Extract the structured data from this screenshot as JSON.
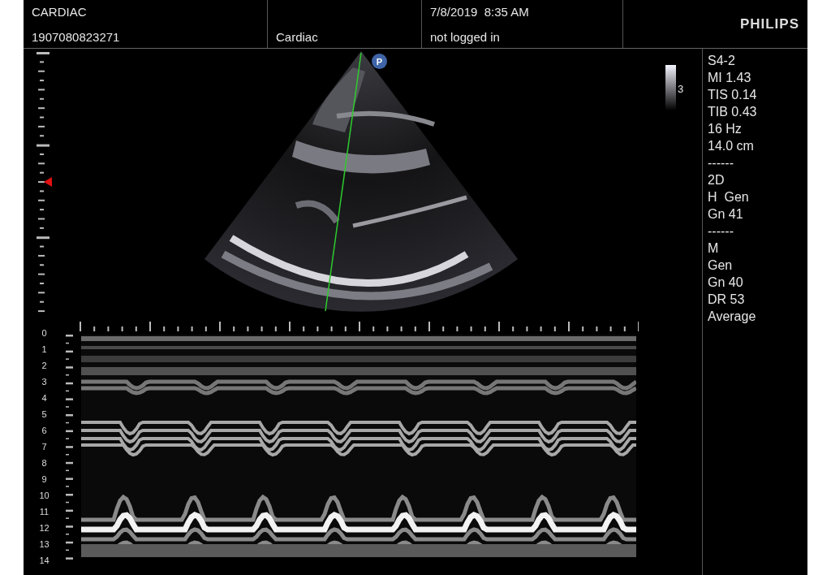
{
  "header": {
    "exam_type": "CARDIAC",
    "patient_id": "1907080823271",
    "preset": "Cardiac",
    "date_time": "7/8/2019  8:35 AM",
    "user_status": "not logged in",
    "logo": "PHILIPS"
  },
  "image": {
    "orientation_marker": "P",
    "gray_scale_label": "3"
  },
  "mmode": {
    "depth_labels": [
      "0",
      "1",
      "2",
      "3",
      "4",
      "5",
      "6",
      "7",
      "8",
      "9",
      "10",
      "11",
      "12",
      "13",
      "14"
    ]
  },
  "parameters": [
    "S4-2",
    "MI 1.43",
    "TIS 0.14",
    "TIB 0.43",
    "16 Hz",
    "14.0 cm",
    "------",
    "2D",
    "H  Gen",
    "Gn 41",
    "------",
    "M",
    "Gen",
    "Gn 40",
    "DR 53",
    "Average"
  ]
}
